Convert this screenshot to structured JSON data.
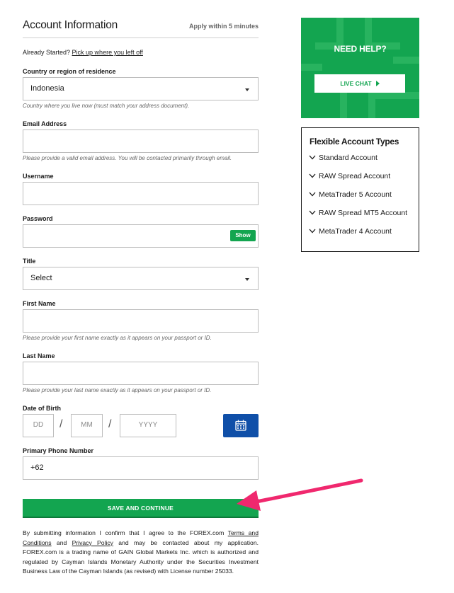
{
  "header": {
    "title": "Account Information",
    "apply_prefix": "Apply within ",
    "apply_time": "5 minutes"
  },
  "already_started": {
    "text": "Already Started? ",
    "link": "Pick up where you left off"
  },
  "country": {
    "label": "Country or region of residence",
    "value": "Indonesia",
    "hint": "Country where you live now (must match your address document)."
  },
  "email": {
    "label": "Email Address",
    "value": "",
    "hint": "Please provide a valid email address. You will be contacted primarily through email."
  },
  "username": {
    "label": "Username",
    "value": ""
  },
  "password": {
    "label": "Password",
    "value": "",
    "show_label": "Show"
  },
  "title_field": {
    "label": "Title",
    "value": "Select"
  },
  "first_name": {
    "label": "First Name",
    "value": "",
    "hint": "Please provide your first name exactly as it appears on your passport or ID."
  },
  "last_name": {
    "label": "Last Name",
    "value": "",
    "hint": "Please provide your last name exactly as it appears on your passport or ID."
  },
  "dob": {
    "label": "Date of Birth",
    "day_placeholder": "DD",
    "month_placeholder": "MM",
    "year_placeholder": "YYYY",
    "separator": "/",
    "calendar_icon": "calendar-icon"
  },
  "phone": {
    "label": "Primary Phone Number",
    "value": "+62"
  },
  "save_button": "SAVE AND CONTINUE",
  "legal": {
    "part1": "By submitting information I confirm that I agree to the FOREX.com ",
    "terms_link": "Terms and Conditions",
    "part2": " and ",
    "privacy_link": "Privacy Policy",
    "part3": " and may be contacted about my application. FOREX.com is a trading name of GAIN Global Markets Inc. which is authorized and regulated by Cayman Islands Monetary Authority under the Securities Investment Business Law of the Cayman Islands (as revised) with License number 25033."
  },
  "help": {
    "title": "NEED HELP?",
    "chat_label": "LIVE CHAT"
  },
  "account_types": {
    "title": "Flexible Account Types",
    "items": [
      "Standard Account",
      "RAW Spread Account",
      "MetaTrader 5 Account",
      "RAW Spread MT5 Account",
      "MetaTrader 4 Account"
    ]
  },
  "colors": {
    "brand_green": "#13a550",
    "calendar_blue": "#0f4fa8",
    "annotation_arrow": "#f0286e"
  }
}
